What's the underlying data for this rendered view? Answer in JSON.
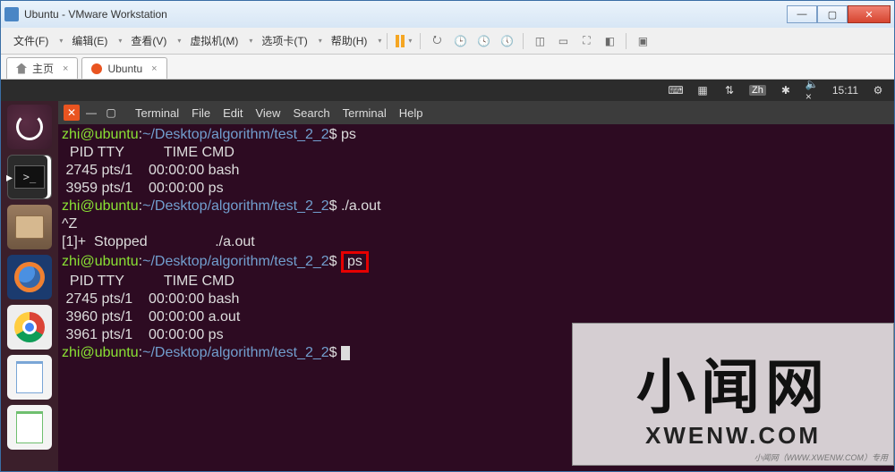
{
  "window": {
    "title": "Ubuntu - VMware Workstation"
  },
  "vm_menu": {
    "file": "文件(F)",
    "edit": "编辑(E)",
    "view": "查看(V)",
    "vm": "虚拟机(M)",
    "tabs": "选项卡(T)",
    "help": "帮助(H)"
  },
  "vm_tabs": {
    "home": "主页",
    "ubuntu": "Ubuntu"
  },
  "ubuntu_topbar": {
    "ime": "Zh",
    "time": "15:11"
  },
  "launcher": {
    "items": [
      {
        "name": "ubuntu-dash"
      },
      {
        "name": "terminal"
      },
      {
        "name": "nautilus-files"
      },
      {
        "name": "firefox"
      },
      {
        "name": "chrome"
      },
      {
        "name": "libreoffice-writer"
      },
      {
        "name": "libreoffice-calc"
      }
    ]
  },
  "terminal": {
    "menu": {
      "terminal": "Terminal",
      "file": "File",
      "edit": "Edit",
      "view": "View",
      "search": "Search",
      "terminal2": "Terminal",
      "help": "Help"
    },
    "prompt_user": "zhi@ubuntu",
    "prompt_path": "~/Desktop/algorithm/test_2_2",
    "lines": {
      "cmd1": "ps",
      "hdr": "  PID TTY          TIME CMD",
      "r1": " 2745 pts/1    00:00:00 bash",
      "r2": " 3959 pts/1    00:00:00 ps",
      "cmd2": "./a.out",
      "ctrlz": "^Z",
      "stopped": "[1]+  Stopped                 ./a.out",
      "cmd3": "ps",
      "hdr2": "  PID TTY          TIME CMD",
      "r3": " 2745 pts/1    00:00:00 bash",
      "r4": " 3960 pts/1    00:00:00 a.out",
      "r5": " 3961 pts/1    00:00:00 ps"
    }
  },
  "watermark": {
    "big": "小闻网",
    "url": "XWENW.COM",
    "small": "小闻网（WWW.XWENW.COM）专用"
  }
}
